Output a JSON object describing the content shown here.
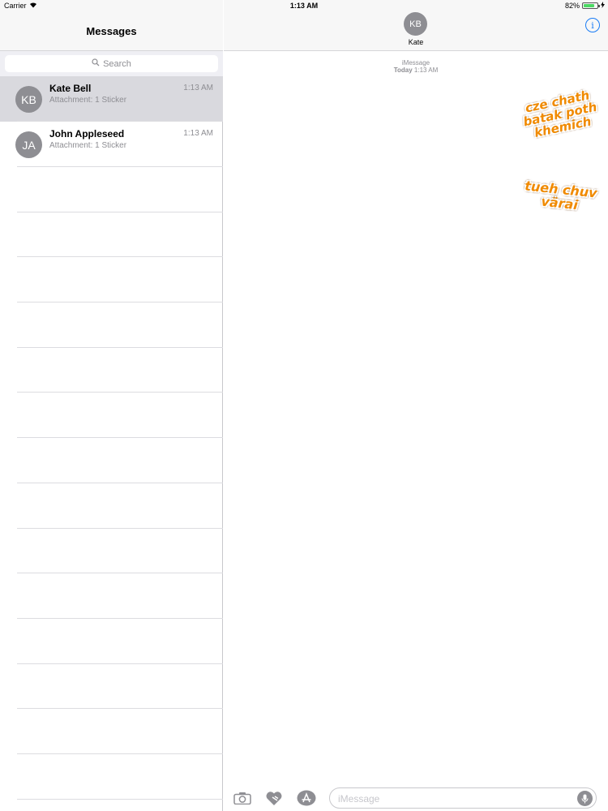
{
  "status_bar": {
    "carrier": "Carrier",
    "time": "1:13 AM",
    "battery_text": "82%",
    "battery_level": 0.82
  },
  "sidebar": {
    "title": "Messages",
    "search_placeholder": "Search",
    "conversations": [
      {
        "initials": "KB",
        "name": "Kate Bell",
        "time": "1:13 AM",
        "preview": "Attachment: 1 Sticker",
        "selected": true
      },
      {
        "initials": "JA",
        "name": "John Appleseed",
        "time": "1:13 AM",
        "preview": "Attachment: 1 Sticker",
        "selected": false
      }
    ]
  },
  "chat": {
    "contact_initials": "KB",
    "contact_name": "Kate",
    "info_label": "i",
    "service": "iMessage",
    "timestamp_day": "Today",
    "timestamp_time": "1:13 AM",
    "stickers": [
      {
        "lines": [
          "cze chath",
          "batak poth",
          "khemich"
        ]
      },
      {
        "lines": [
          "tueh chuv",
          "värai"
        ]
      }
    ],
    "composer": {
      "placeholder": "iMessage"
    }
  },
  "colors": {
    "accent": "#1a7cf5",
    "avatar": "#8e8e93",
    "battery": "#4cd964",
    "sticker": "#f08a00"
  },
  "icons": [
    "wifi-icon",
    "battery-icon",
    "search-icon",
    "info-icon",
    "camera-icon",
    "digital-touch-icon",
    "app-store-icon",
    "microphone-icon"
  ]
}
